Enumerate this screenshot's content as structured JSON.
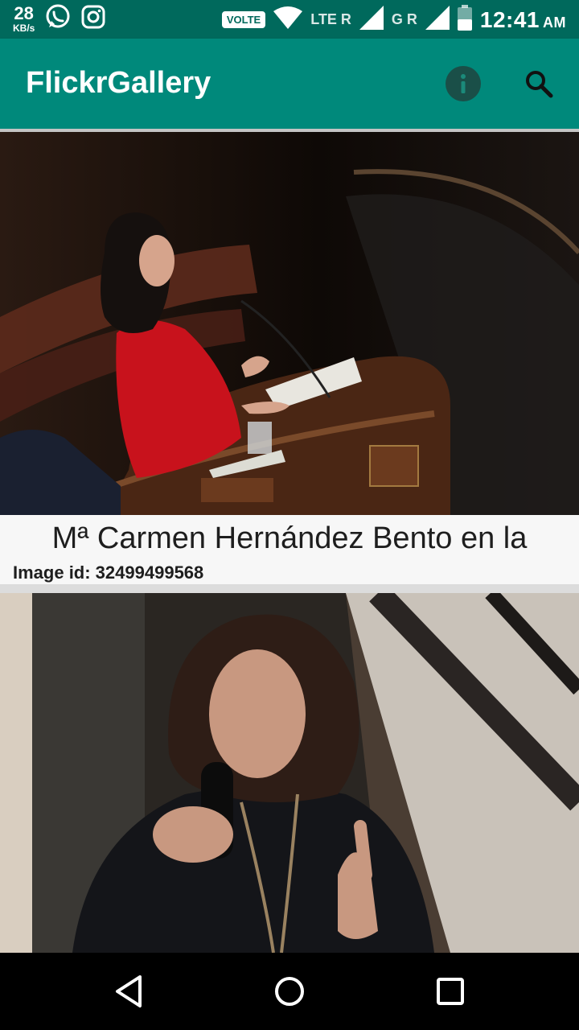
{
  "status_bar": {
    "speed_value": "28",
    "speed_unit": "KB/s",
    "volte": "VOLTE",
    "network1": "LTE R",
    "network2": "G R",
    "time": "12:41",
    "ampm": "AM",
    "icons": [
      "whatsapp-icon",
      "instagram-icon",
      "wifi-icon",
      "signal-icon",
      "signal-icon",
      "battery-icon"
    ]
  },
  "app_bar": {
    "title": "FlickrGallery",
    "icons": [
      "info-icon",
      "search-icon"
    ]
  },
  "photos": [
    {
      "title": "Mª Carmen Hernández Bento en la",
      "image_id_text": "Image id: 32499499568"
    },
    {}
  ],
  "nav_bar": {
    "icons": [
      "back-icon",
      "home-icon",
      "recents-icon"
    ]
  },
  "colors": {
    "status_bar": "#00695c",
    "app_bar": "#00897b",
    "info_button": "#1a4f48"
  }
}
